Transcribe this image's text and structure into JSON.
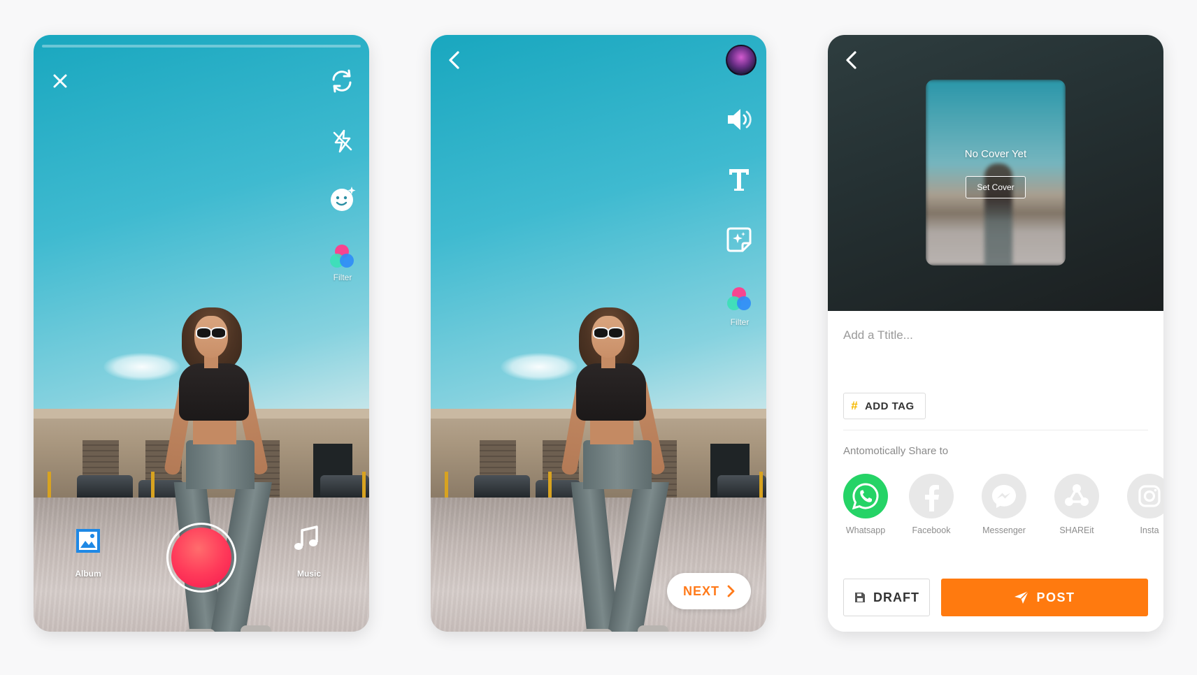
{
  "screen1": {
    "filter_label": "Filter",
    "album_label": "Album",
    "music_label": "Music",
    "recording_progress": 0
  },
  "screen2": {
    "filter_label": "Filter",
    "next_label": "NEXT"
  },
  "screen3": {
    "cover": {
      "text": "No Cover Yet",
      "button_label": "Set Cover"
    },
    "title_placeholder": "Add a Ttitle...",
    "add_tag_label": "ADD TAG",
    "share_heading": "Antomotically Share to",
    "share_targets": [
      {
        "name": "Whatsapp",
        "icon": "whatsapp-icon",
        "active": true,
        "color": "#25d366"
      },
      {
        "name": "Facebook",
        "icon": "facebook-icon",
        "active": false,
        "color": "#e0e0e0"
      },
      {
        "name": "Messenger",
        "icon": "messenger-icon",
        "active": false,
        "color": "#e0e0e0"
      },
      {
        "name": "SHAREit",
        "icon": "shareit-icon",
        "active": false,
        "color": "#e0e0e0"
      },
      {
        "name": "Insta",
        "icon": "instagram-icon",
        "active": false,
        "color": "#e0e0e0"
      }
    ],
    "draft_label": "DRAFT",
    "post_label": "POST"
  },
  "colors": {
    "accent_orange": "#ff7a0f",
    "record_red": "#f5174d",
    "whatsapp_green": "#25d366"
  }
}
